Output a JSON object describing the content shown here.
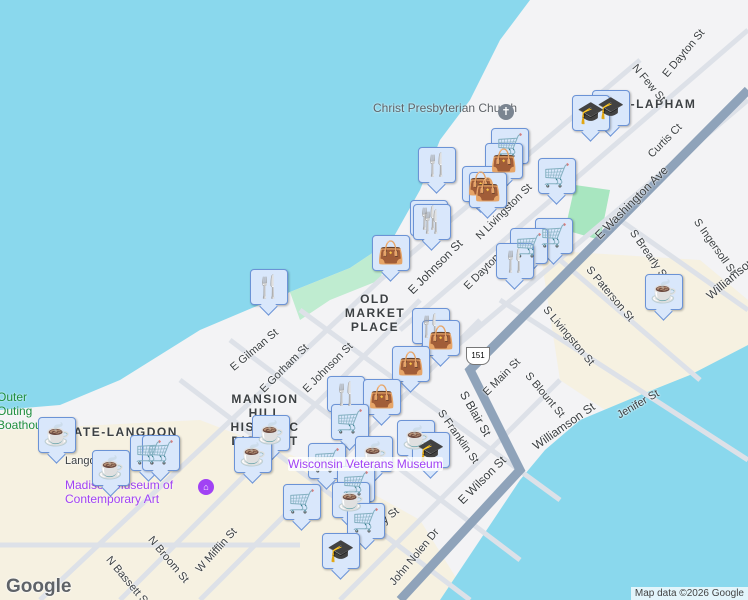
{
  "map": {
    "areas": [
      "OLD MARKET PLACE",
      "MANSION HILL HISTORIC DISTRICT",
      "MATE-LANGDON",
      "TENNEY-LAPHAM"
    ],
    "pois": {
      "church": "Christ Presbyterian Church",
      "museum": "Madison Museum of Contemporary Art",
      "veterans": "Wisconsin Veterans Museum",
      "boathouse": "Outer Outing Boathouse"
    },
    "streets": [
      "E Gorham St",
      "E Johnson St",
      "E Gilman St",
      "N Broom St",
      "W Mifflin St",
      "N Bassett St",
      "S Blair St",
      "E Wilson St",
      "S Franklin St",
      "E Washington Ave",
      "E Dayton St",
      "N Few St",
      "Curtis Ct",
      "S Paterson St",
      "S Livingston St",
      "S Blount St",
      "E Main St",
      "S Brearly St",
      "S Ingersoll St",
      "Williamson St",
      "Jenifer St",
      "John Nolen Dr",
      "Doty St",
      "N Livingston St",
      "E Johnson St",
      "Langdon St"
    ],
    "route_shield": "151",
    "marker_icons": {
      "restaurant": "fork-knife-icon",
      "shopping": "shopping-bag-icon",
      "grocery": "cart-icon",
      "cafe": "coffee-cup-icon",
      "school": "graduation-cap-icon"
    }
  },
  "footer": {
    "logo": "Google",
    "attribution": "Map data ©2026 Google"
  },
  "colors": {
    "water": "#8ad8ed",
    "land": "#f3f3f5",
    "park": "#a8e6c0",
    "road": "#dde1e8",
    "highway": "#8fa3ba",
    "marker_bg": "#d9e7fb",
    "marker_icon": "#0d4169"
  }
}
